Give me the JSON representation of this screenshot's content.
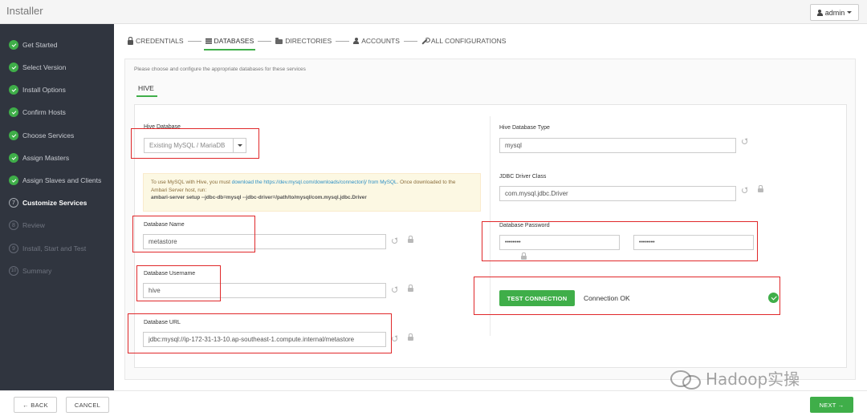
{
  "app": {
    "title": "Installer",
    "user": "admin"
  },
  "sidebar": {
    "steps": [
      {
        "label": "Get Started",
        "state": "done"
      },
      {
        "label": "Select Version",
        "state": "done"
      },
      {
        "label": "Install Options",
        "state": "done"
      },
      {
        "label": "Confirm Hosts",
        "state": "done"
      },
      {
        "label": "Choose Services",
        "state": "done"
      },
      {
        "label": "Assign Masters",
        "state": "done"
      },
      {
        "label": "Assign Slaves and Clients",
        "state": "done"
      },
      {
        "label": "Customize Services",
        "state": "active",
        "num": "7"
      },
      {
        "label": "Review",
        "state": "future",
        "num": "8"
      },
      {
        "label": "Install, Start and Test",
        "state": "future",
        "num": "9"
      },
      {
        "label": "Summary",
        "state": "future",
        "num": "10"
      }
    ]
  },
  "tabs": {
    "credentials": "CREDENTIALS",
    "databases": "DATABASES",
    "directories": "DIRECTORIES",
    "accounts": "ACCOUNTS",
    "all_configurations": "ALL CONFIGURATIONS"
  },
  "intro": "Please choose and configure the appropriate databases for these services",
  "service_tab": "HIVE",
  "left": {
    "hive_database_label": "Hive Database",
    "hive_database_value": "Existing MySQL / MariaDB",
    "alert": {
      "pre": "To use MySQL with Hive, you must ",
      "link1": "download the https://dev.mysql.com/downloads/connector/j/ from MySQL",
      "mid": ". Once downloaded to the Ambari Server host, run:",
      "cmd": "ambari-server setup --jdbc-db=mysql --jdbc-driver=/path/to/mysql/com.mysql.jdbc.Driver"
    },
    "db_name_label": "Database Name",
    "db_name_value": "metastore",
    "db_user_label": "Database Username",
    "db_user_value": "hive",
    "db_url_label": "Database URL",
    "db_url_value": "jdbc:mysql://ip-172-31-13-10.ap-southeast-1.compute.internal/metastore"
  },
  "right": {
    "db_type_label": "Hive Database Type",
    "db_type_value": "mysql",
    "jdbc_label": "JDBC Driver Class",
    "jdbc_value": "com.mysql.jdbc.Driver",
    "pw_label": "Database Password",
    "pw_value": "••••••••",
    "pw_confirm_value": "••••••••",
    "test_button": "TEST CONNECTION",
    "connection_status": "Connection OK"
  },
  "footer": {
    "back": "← BACK",
    "cancel": "CANCEL",
    "next": "NEXT →"
  },
  "watermark": "Hadoop实操",
  "colors": {
    "accent": "#3fae49",
    "highlight": "#e0282a",
    "sidebar": "#30353f"
  }
}
